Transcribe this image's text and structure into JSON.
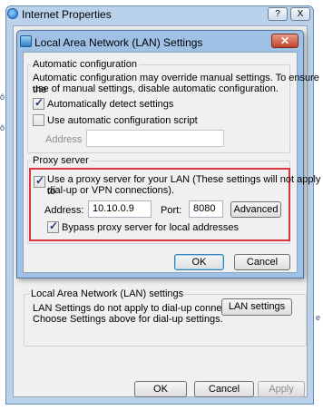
{
  "outer_window": {
    "title": "Internet Properties",
    "help_button": "?",
    "close_button": "X",
    "lan_group_title": "Local Area Network (LAN) settings",
    "lan_group_text_line1": "LAN Settings do not apply to dial-up connections.",
    "lan_group_text_line2": "Choose Settings above for dial-up settings.",
    "lan_settings_button": "LAN settings",
    "ok_button": "OK",
    "cancel_button": "Cancel",
    "apply_button": "Apply"
  },
  "dialog": {
    "title": "Local Area Network (LAN) Settings",
    "close_symbol": "✕",
    "automatic_configuration": {
      "legend": "Automatic configuration",
      "description_line1": "Automatic configuration may override manual settings.  To ensure the",
      "description_line2": "use of manual settings, disable automatic configuration.",
      "auto_detect_label": "Automatically detect settings",
      "auto_detect_checked": true,
      "use_script_label": "Use automatic configuration script",
      "use_script_checked": false,
      "address_label": "Address",
      "address_value": ""
    },
    "proxy_server": {
      "legend": "Proxy server",
      "use_proxy_label_line1": "Use a proxy server for your LAN (These settings will not apply to",
      "use_proxy_label_line2": "dial-up or VPN connections).",
      "use_proxy_checked": true,
      "address_label": "Address:",
      "address_value": "10.10.0.9",
      "port_label": "Port:",
      "port_value": "8080",
      "advanced_button": "Advanced",
      "bypass_label": "Bypass proxy server for local addresses",
      "bypass_checked": true
    },
    "ok_button": "OK",
    "cancel_button": "Cancel"
  },
  "colors": {
    "highlight_border": "#d9363e",
    "close_button": "#c2452b",
    "title_bar": "#9fc1e6"
  }
}
